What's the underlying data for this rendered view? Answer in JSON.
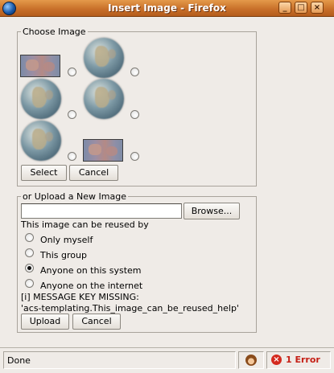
{
  "window": {
    "title": "Insert Image - Firefox",
    "buttons": {
      "minimize": "_",
      "maximize": "□",
      "close": "×"
    }
  },
  "choose_image": {
    "legend": "Choose Image",
    "select_label": "Select",
    "cancel_label": "Cancel"
  },
  "upload": {
    "legend": "or Upload a New Image",
    "file_value": "",
    "browse_label": "Browse...",
    "reuse_label": "This image can be reused by",
    "options": [
      {
        "label": "Only myself",
        "checked": false
      },
      {
        "label": "This group",
        "checked": false
      },
      {
        "label": "Anyone on this system",
        "checked": true
      },
      {
        "label": "Anyone on the internet",
        "checked": false
      }
    ],
    "help_line1": "[i] MESSAGE KEY MISSING:",
    "help_line2": "'acs-templating.This_image_can_be_reused_help'",
    "upload_label": "Upload",
    "cancel_label": "Cancel"
  },
  "statusbar": {
    "status_text": "Done",
    "error_text": "1 Error"
  }
}
